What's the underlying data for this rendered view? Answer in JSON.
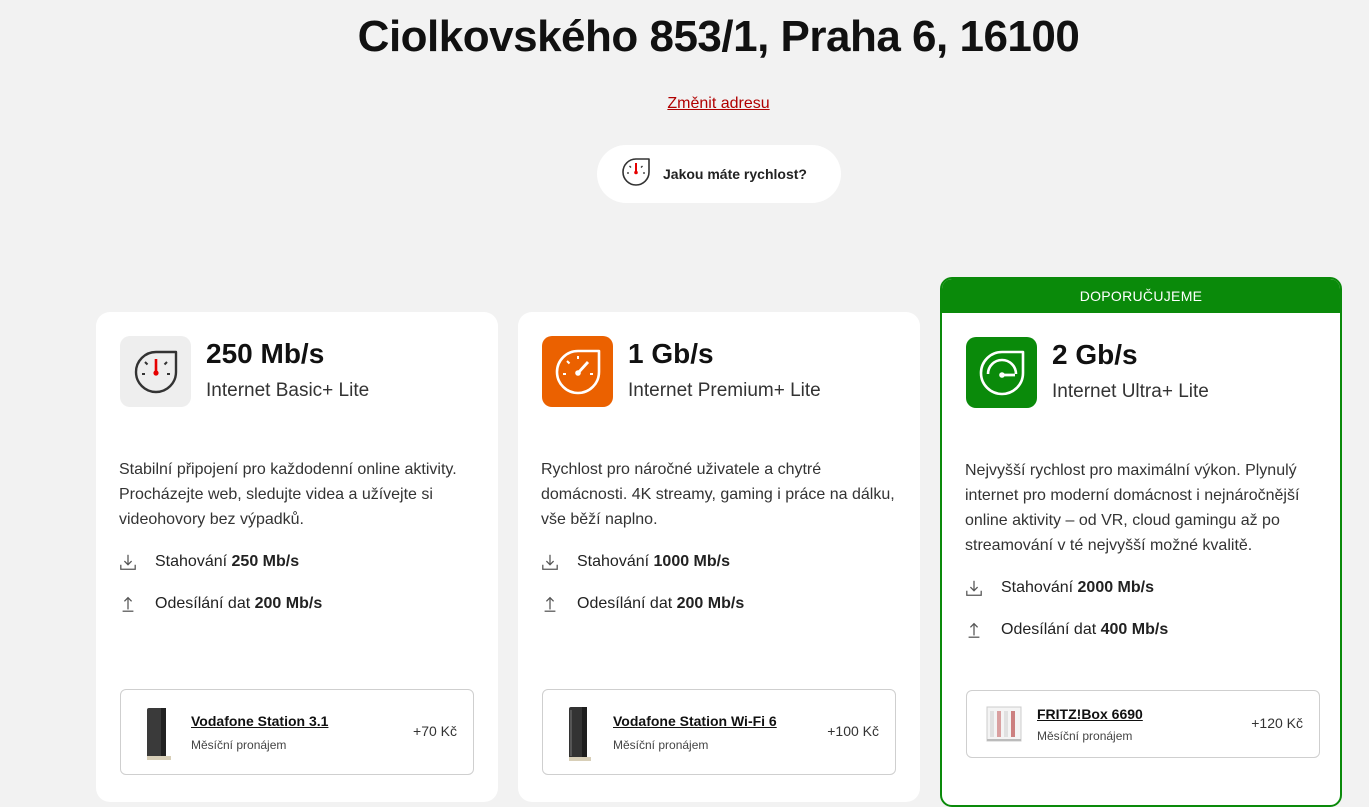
{
  "address": {
    "title": "Ciolkovského 853/1, Praha 6, 16100",
    "change_link": "Změnit adresu"
  },
  "speed_test": {
    "label": "Jakou máte rychlost?",
    "icon": "speedometer-icon"
  },
  "colors": {
    "accent_red": "#e60000",
    "orange": "#eb6100",
    "green": "#0a8a0a"
  },
  "plans": [
    {
      "speed": "250 Mb/s",
      "name": "Internet Basic+ Lite",
      "description": "Stabilní připojení pro každodenní online aktivity. Procházejte web, sledujte videa a užívejte si videohovory bez výpadků.",
      "download_label": "Stahování",
      "download_value": "250 Mb/s",
      "upload_label": "Odesílání dat",
      "upload_value": "200 Mb/s",
      "device": {
        "name": "Vodafone Station 3.1",
        "sub": "Měsíční pronájem",
        "price": "+70 Kč"
      }
    },
    {
      "speed": "1 Gb/s",
      "name": "Internet Premium+ Lite",
      "description": "Rychlost pro náročné uživatele a chytré domácnosti. 4K streamy, gaming i práce na dálku, vše běží naplno.",
      "download_label": "Stahování",
      "download_value": "1000 Mb/s",
      "upload_label": "Odesílání dat",
      "upload_value": "200 Mb/s",
      "device": {
        "name": "Vodafone Station Wi-Fi 6",
        "sub": "Měsíční pronájem",
        "price": "+100 Kč"
      }
    },
    {
      "badge": "DOPORUČUJEME",
      "speed": "2 Gb/s",
      "name": "Internet Ultra+ Lite",
      "description": "Nejvyšší rychlost pro maximální výkon. Plynulý internet pro moderní domácnost i nejnáročnější online aktivity – od VR, cloud gamingu až po streamování v té nejvyšší možné kvalitě.",
      "download_label": "Stahování",
      "download_value": "2000 Mb/s",
      "upload_label": "Odesílání dat",
      "upload_value": "400 Mb/s",
      "device": {
        "name": "FRITZ!Box 6690",
        "sub": "Měsíční pronájem",
        "price": "+120 Kč"
      }
    }
  ]
}
